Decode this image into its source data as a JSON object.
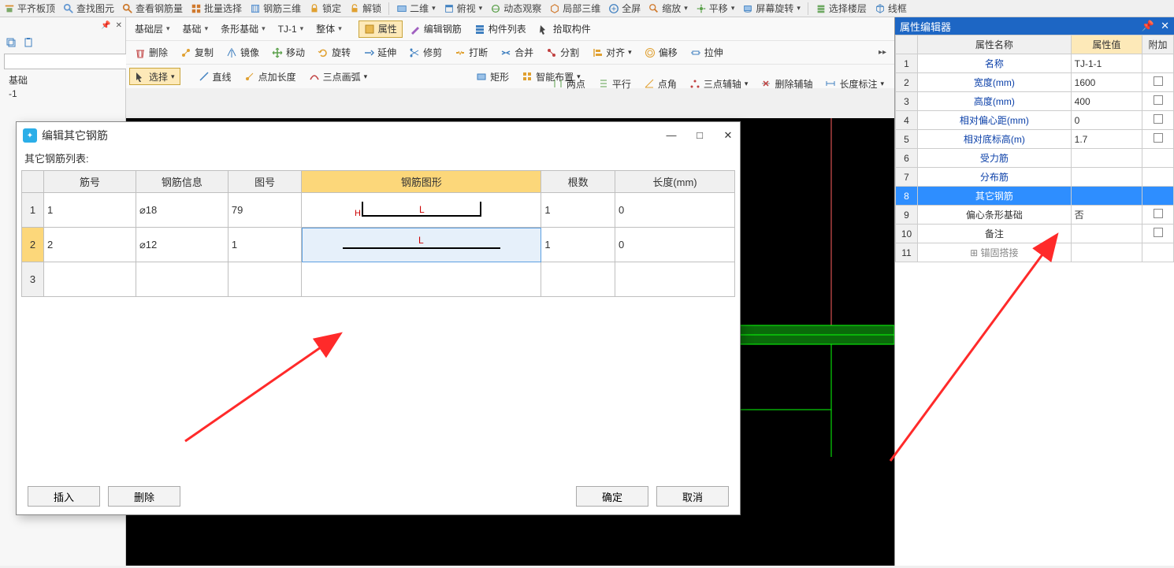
{
  "top_toolbar": {
    "items": [
      "平齐板顶",
      "查找图元",
      "查看钢筋量",
      "批量选择",
      "钢筋三维",
      "锁定",
      "解锁"
    ],
    "items2": [
      "二维",
      "俯视",
      "动态观察",
      "局部三维",
      "全屏",
      "缩放",
      "平移",
      "屏幕旋转"
    ],
    "items3": [
      "选择楼层",
      "线框"
    ]
  },
  "sidebar": {
    "pin": "📌",
    "close": "✕",
    "tree": [
      "基础",
      "-1"
    ]
  },
  "bar1": {
    "d1": "基础层",
    "d2": "基础",
    "d3": "条形基础",
    "d4": "TJ-1",
    "d5": "整体",
    "p1": "属性",
    "p2": "编辑钢筋",
    "p3": "构件列表",
    "p4": "拾取构件"
  },
  "bar2": {
    "items": [
      "删除",
      "复制",
      "镜像",
      "移动",
      "旋转",
      "延伸",
      "修剪",
      "打断",
      "合并",
      "分割",
      "对齐",
      "偏移",
      "拉伸"
    ]
  },
  "bar3": {
    "items": [
      "选择",
      "直线",
      "点加长度",
      "三点画弧",
      "矩形",
      "智能布置"
    ]
  },
  "bar4": {
    "items": [
      "两点",
      "平行",
      "点角",
      "三点辅轴",
      "删除辅轴",
      "长度标注"
    ]
  },
  "prop": {
    "title": "属性编辑器",
    "h1": "属性名称",
    "h2": "属性值",
    "h3": "附加",
    "rows": [
      {
        "i": "1",
        "n": "名称",
        "v": "TJ-1-1",
        "link": true
      },
      {
        "i": "2",
        "n": "宽度(mm)",
        "v": "1600",
        "chk": true,
        "link": true
      },
      {
        "i": "3",
        "n": "高度(mm)",
        "v": "400",
        "chk": true,
        "link": true
      },
      {
        "i": "4",
        "n": "相对偏心距(mm)",
        "v": "0",
        "chk": true,
        "link": true
      },
      {
        "i": "5",
        "n": "相对底标高(m)",
        "v": "1.7",
        "chk": true,
        "link": true
      },
      {
        "i": "6",
        "n": "受力筋",
        "v": "",
        "link": true
      },
      {
        "i": "7",
        "n": "分布筋",
        "v": "",
        "link": true
      },
      {
        "i": "8",
        "n": "其它钢筋",
        "v": "",
        "sel": true,
        "link": true
      },
      {
        "i": "9",
        "n": "偏心条形基础",
        "v": "否",
        "chk": true
      },
      {
        "i": "10",
        "n": "备注",
        "v": "",
        "chk": true
      },
      {
        "i": "11",
        "n": "锚固搭接",
        "v": "",
        "expand": true,
        "grey": true
      }
    ]
  },
  "dialog": {
    "title": "编辑其它钢筋",
    "subtitle": "其它钢筋列表:",
    "headers": [
      "",
      "筋号",
      "钢筋信息",
      "图号",
      "钢筋图形",
      "根数",
      "长度(mm)"
    ],
    "rows": [
      {
        "i": "1",
        "no": "1",
        "info": "⌀18",
        "fig": "79",
        "shape": "u",
        "count": "1",
        "len": "0",
        "Hlabel": "H",
        "Llabel": "L"
      },
      {
        "i": "2",
        "no": "2",
        "info": "⌀12",
        "fig": "1",
        "shape": "line",
        "count": "1",
        "len": "0",
        "Llabel": "L",
        "sel": true
      },
      {
        "i": "3",
        "no": "",
        "info": "",
        "fig": "",
        "shape": "",
        "count": "",
        "len": ""
      }
    ],
    "btns": {
      "insert": "插入",
      "delete": "删除",
      "ok": "确定",
      "cancel": "取消"
    },
    "win": {
      "min": "—",
      "max": "□",
      "close": "✕"
    }
  }
}
